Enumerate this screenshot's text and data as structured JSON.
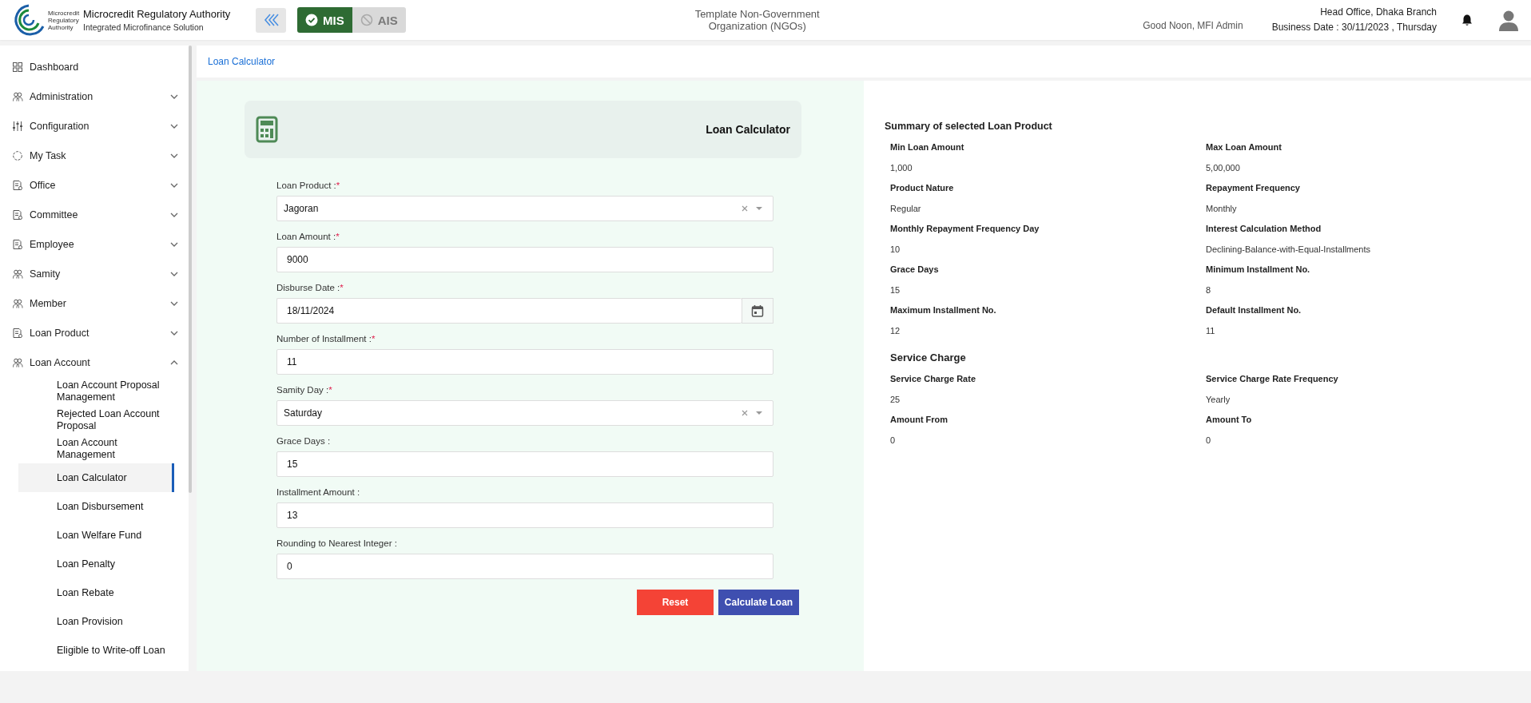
{
  "header": {
    "org_name": "Microcredit Regulatory Authority",
    "org_subtitle": "Integrated Microfinance Solution",
    "logo_text": [
      "Microcredit",
      "Regulatory",
      "Authority"
    ],
    "modules": [
      {
        "label": "MIS",
        "selected": true
      },
      {
        "label": "AIS",
        "selected": false
      }
    ],
    "organization": "Template Non-Government Organization (NGOs)",
    "greeting": "Good Noon, MFI Admin",
    "branch": "Head Office, Dhaka Branch",
    "business_date": "Business Date : 30/11/2023 , Thursday"
  },
  "sidebar": {
    "items": [
      {
        "label": "Dashboard",
        "kind": "link"
      },
      {
        "label": "Administration",
        "kind": "group",
        "expanded": false
      },
      {
        "label": "Configuration",
        "kind": "group",
        "expanded": false
      },
      {
        "label": "My Task",
        "kind": "group",
        "expanded": false
      },
      {
        "label": "Office",
        "kind": "group",
        "expanded": false
      },
      {
        "label": "Committee",
        "kind": "group",
        "expanded": false
      },
      {
        "label": "Employee",
        "kind": "group",
        "expanded": false
      },
      {
        "label": "Samity",
        "kind": "group",
        "expanded": false
      },
      {
        "label": "Member",
        "kind": "group",
        "expanded": false
      },
      {
        "label": "Loan Product",
        "kind": "group",
        "expanded": false
      },
      {
        "label": "Loan Account",
        "kind": "group",
        "expanded": true,
        "children": [
          {
            "label": "Loan Account Proposal Management",
            "selected": false
          },
          {
            "label": "Rejected Loan Account Proposal",
            "selected": false
          },
          {
            "label": "Loan Account Management",
            "selected": false
          },
          {
            "label": "Loan Calculator",
            "selected": true
          },
          {
            "label": "Loan Disbursement",
            "selected": false
          },
          {
            "label": "Loan Welfare Fund",
            "selected": false
          },
          {
            "label": "Loan Penalty",
            "selected": false
          },
          {
            "label": "Loan Rebate",
            "selected": false
          },
          {
            "label": "Loan Provision",
            "selected": false
          },
          {
            "label": "Eligible to Write-off Loan",
            "selected": false
          }
        ]
      }
    ]
  },
  "breadcrumb": "Loan Calculator",
  "form": {
    "title": "Loan Calculator",
    "fields": [
      {
        "label": "Loan Product :",
        "required": true,
        "kind": "select",
        "value": "Jagoran"
      },
      {
        "label": "Loan Amount :",
        "required": true,
        "kind": "text",
        "value": "9000"
      },
      {
        "label": "Disburse Date :",
        "required": true,
        "kind": "date",
        "value": "18/11/2024"
      },
      {
        "label": "Number of Installment :",
        "required": true,
        "kind": "text",
        "value": "11"
      },
      {
        "label": "Samity Day :",
        "required": true,
        "kind": "select",
        "value": "Saturday"
      },
      {
        "label": "Grace Days :",
        "required": false,
        "kind": "text",
        "value": "15"
      },
      {
        "label": "Installment Amount :",
        "required": false,
        "kind": "text",
        "value": "13"
      },
      {
        "label": "Rounding to Nearest Integer :",
        "required": false,
        "kind": "text",
        "value": "0"
      }
    ],
    "required_mark": "*",
    "buttons": [
      {
        "label": "Reset",
        "kind": "reset"
      },
      {
        "label": "Calculate Loan",
        "kind": "primary"
      }
    ]
  },
  "summary": {
    "title": "Summary of selected Loan Product",
    "items": [
      {
        "label": "Min Loan Amount",
        "value": "1,000"
      },
      {
        "label": "Max Loan Amount",
        "value": "5,00,000"
      },
      {
        "label": "Product Nature",
        "value": "Regular"
      },
      {
        "label": "Repayment Frequency",
        "value": "Monthly"
      },
      {
        "label": "Monthly Repayment Frequency Day",
        "value": "10"
      },
      {
        "label": "Interest Calculation Method",
        "value": "Declining-Balance-with-Equal-Installments"
      },
      {
        "label": "Grace Days",
        "value": "15"
      },
      {
        "label": "Minimum Installment No.",
        "value": "8"
      },
      {
        "label": "Maximum Installment No.",
        "value": "12"
      },
      {
        "label": "Default Installment No.",
        "value": "11"
      }
    ],
    "service_charge": {
      "title": "Service Charge",
      "items": [
        {
          "label": "Service Charge Rate",
          "value": "25"
        },
        {
          "label": "Service Charge Rate Frequency",
          "value": "Yearly"
        },
        {
          "label": "Amount From",
          "value": "0"
        },
        {
          "label": "Amount To",
          "value": "0"
        }
      ]
    }
  }
}
